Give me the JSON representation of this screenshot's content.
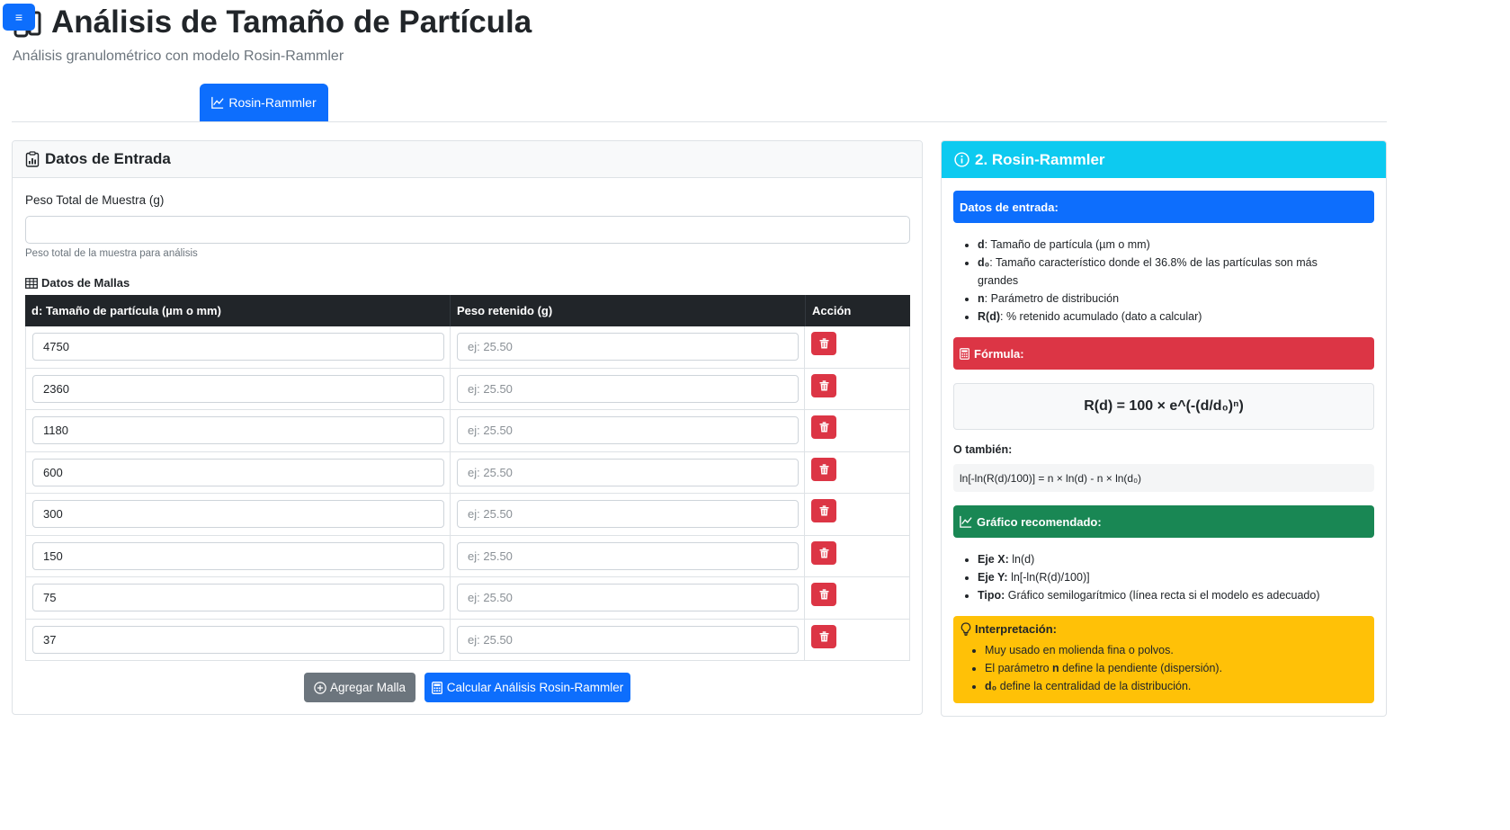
{
  "menu": {
    "icon": "≡"
  },
  "header": {
    "title": "Análisis de Tamaño de Partícula",
    "subtitle": "Análisis granulométrico con modelo Rosin-Rammler"
  },
  "tabs": [
    {
      "label": "Rosin-Rammler",
      "active": true
    }
  ],
  "input_card": {
    "title": "Datos de Entrada",
    "peso_label": "Peso Total de Muestra (g)",
    "peso_value": "",
    "peso_help": "Peso total de la muestra para análisis",
    "mallas_title": "Datos de Mallas",
    "columns": [
      "d: Tamaño de partícula (µm o mm)",
      "Peso retenido (g)",
      "Acción"
    ],
    "rows": [
      {
        "d": "4750",
        "peso_placeholder": "ej: 25.50"
      },
      {
        "d": "2360",
        "peso_placeholder": "ej: 25.50"
      },
      {
        "d": "1180",
        "peso_placeholder": "ej: 25.50"
      },
      {
        "d": "600",
        "peso_placeholder": "ej: 25.50"
      },
      {
        "d": "300",
        "peso_placeholder": "ej: 25.50"
      },
      {
        "d": "150",
        "peso_placeholder": "ej: 25.50"
      },
      {
        "d": "75",
        "peso_placeholder": "ej: 25.50"
      },
      {
        "d": "37",
        "peso_placeholder": "ej: 25.50"
      }
    ],
    "add_button": "Agregar Malla",
    "calc_button": "Calcular Análisis Rosin-Rammler"
  },
  "info_card": {
    "title": "2. Rosin-Rammler",
    "datos_title": "Datos de entrada:",
    "datos_items": [
      {
        "term": "d",
        "desc": ": Tamaño de partícula (µm o mm)"
      },
      {
        "term": "d₀",
        "desc": ": Tamaño característico donde el 36.8% de las partículas son más grandes"
      },
      {
        "term": "n",
        "desc": ": Parámetro de distribución"
      },
      {
        "term": "R(d)",
        "desc": ": % retenido acumulado (dato a calcular)"
      }
    ],
    "formula_title": "Fórmula:",
    "formula": "R(d) = 100 × e^(-(d/d₀)ⁿ)",
    "alt_label": "O también:",
    "alt_formula": "ln[-ln(R(d)/100)] = n × ln(d) - n × ln(d₀)",
    "grafico_title": "Gráfico recomendado:",
    "grafico_items": [
      {
        "term": "Eje X:",
        "desc": " ln(d)"
      },
      {
        "term": "Eje Y:",
        "desc": " ln[-ln(R(d)/100)]"
      },
      {
        "term": "Tipo:",
        "desc": " Gráfico semilogarítmico (línea recta si el modelo es adecuado)"
      }
    ],
    "interp_title": "Interpretación:",
    "interp_items": [
      {
        "pre": "Muy usado en molienda fina o polvos.",
        "bold": "",
        "post": ""
      },
      {
        "pre": "El parámetro ",
        "bold": "n",
        "post": " define la pendiente (dispersión)."
      },
      {
        "pre": "",
        "bold": "d₀",
        "post": " define la centralidad de la distribución."
      }
    ]
  },
  "colors": {
    "primary": "#0d6efd",
    "danger": "#dc3545",
    "success": "#198754",
    "warning": "#ffc107",
    "info": "#0dcaf0",
    "secondary": "#6c757d",
    "dark": "#212529"
  }
}
